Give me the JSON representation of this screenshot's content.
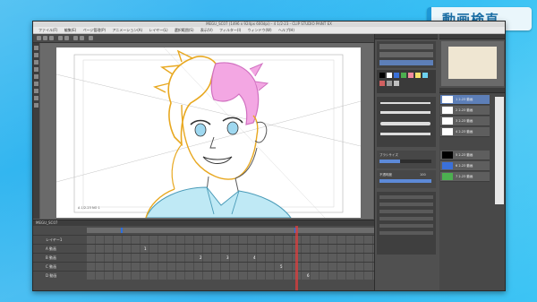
{
  "badge": {
    "title": "動画検直",
    "accent": "#1e97d6"
  },
  "window": {
    "title": "MEGU_SC07 (1496 x 924px 600dpi) - 4 1/2-23 - CLIP STUDIO PAINT EX",
    "menu": [
      "ファイル(F)",
      "編集(E)",
      "ページ管理(P)",
      "アニメーション(A)",
      "レイヤー(L)",
      "選択範囲(S)",
      "表示(V)",
      "フィルター(I)",
      "ウィンドウ(W)",
      "ヘルプ(H)"
    ]
  },
  "canvas": {
    "corner_note": "A 1/2-23 NO 1",
    "figure": "anime-character-sketch-icon"
  },
  "timeline": {
    "header": "MEGU_SC07",
    "tracks": [
      {
        "label": "レイヤー1"
      },
      {
        "label": "A  動画"
      },
      {
        "label": "B  動画"
      },
      {
        "label": "C  動画"
      },
      {
        "label": "D  動画"
      }
    ],
    "frame_numbers": [
      "1",
      "2",
      "3",
      "4",
      "5",
      "6"
    ],
    "playhead_color": "#e63c3c",
    "marker_color": "#2c6fe0"
  },
  "panels": {
    "color_swatches": [
      "#000000",
      "#ffffff",
      "#3a70d8",
      "#4caf50",
      "#f28aa0",
      "#f4e06a",
      "#6dd2f0",
      "#d06060",
      "#999999",
      "#c0c0c0"
    ],
    "layers": [
      "1 2-23 動画",
      "2 2-23 動画",
      "3 2-23 動画",
      "4 2-23 動画",
      "5 2-23 動画",
      "6 2-23 動画",
      "7 2-23 動画"
    ],
    "brush_section": "ブラシサイズ",
    "opacity_label": "不透明度",
    "opacity_value": "100"
  }
}
